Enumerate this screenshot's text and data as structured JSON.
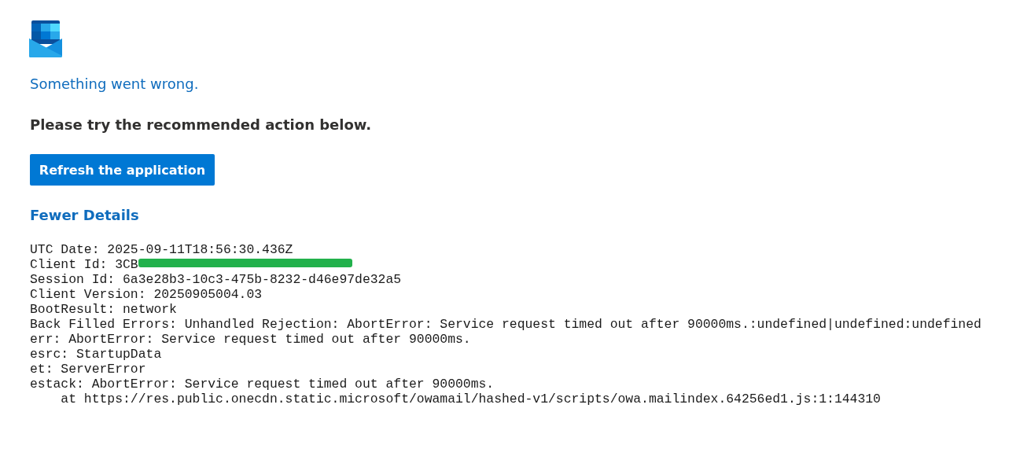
{
  "error_title": "Something went wrong.",
  "instruction": "Please try the recommended action below.",
  "refresh_button": "Refresh the application",
  "details_toggle": "Fewer Details",
  "details": [
    {
      "kind": "plain",
      "text": "UTC Date: 2025-09-11T18:56:30.436Z"
    },
    {
      "kind": "redacted",
      "text": "Client Id: 3CB"
    },
    {
      "kind": "plain",
      "text": "Session Id: 6a3e28b3-10c3-475b-8232-d46e97de32a5"
    },
    {
      "kind": "plain",
      "text": "Client Version: 20250905004.03"
    },
    {
      "kind": "plain",
      "text": "BootResult: network"
    },
    {
      "kind": "plain",
      "text": "Back Filled Errors: Unhandled Rejection: AbortError: Service request timed out after 90000ms.:undefined|undefined:undefined"
    },
    {
      "kind": "plain",
      "text": "err: AbortError: Service request timed out after 90000ms."
    },
    {
      "kind": "plain",
      "text": "esrc: StartupData"
    },
    {
      "kind": "plain",
      "text": "et: ServerError"
    },
    {
      "kind": "plain",
      "text": "estack: AbortError: Service request timed out after 90000ms."
    },
    {
      "kind": "continuation",
      "text": "at https://res.public.onecdn.static.microsoft/owamail/hashed-v1/scripts/owa.mailindex.64256ed1.js:1:144310"
    }
  ]
}
